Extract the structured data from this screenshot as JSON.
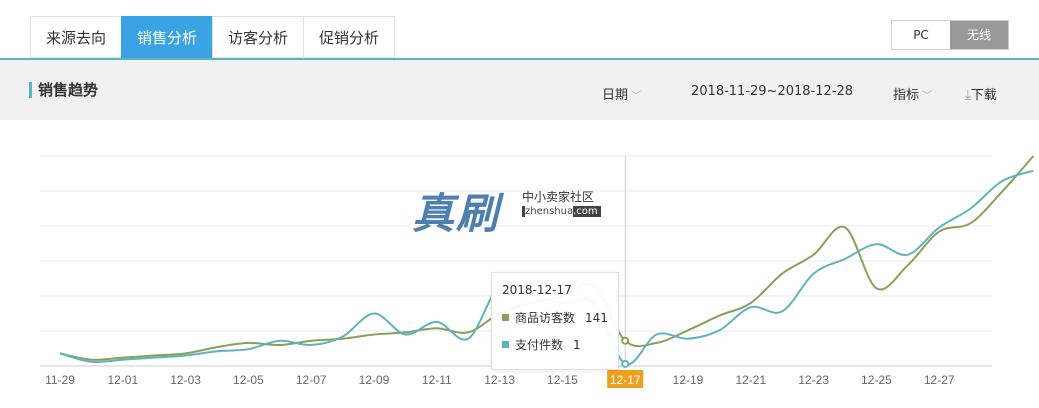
{
  "tabs": [
    {
      "label": "来源去向",
      "active": false
    },
    {
      "label": "销售分析",
      "active": true
    },
    {
      "label": "访客分析",
      "active": false
    },
    {
      "label": "促销分析",
      "active": false
    }
  ],
  "device_switch": {
    "pc": "PC",
    "wireless": "无线",
    "selected": "无线"
  },
  "header": {
    "title": "销售趋势",
    "date_label": "日期",
    "date_range": "2018-11-29~2018-12-28",
    "metric_label": "指标",
    "download_label": "下载",
    "accent_color": "#5ab6c0"
  },
  "watermark": {
    "big": "真刷",
    "small": "中小卖家社区",
    "domain_a": "zhenshua",
    "domain_b": ".com"
  },
  "tooltip": {
    "date": "2018-12-17",
    "rows": [
      {
        "label": "商品访客数",
        "value": "141",
        "color": "#8aa05a"
      },
      {
        "label": "支付件数",
        "value": "1",
        "color": "#5fb3bd"
      }
    ]
  },
  "chart_data": {
    "type": "line",
    "highlight_index": 18,
    "x_tick_labels": [
      "11-29",
      "12-01",
      "12-03",
      "12-05",
      "12-07",
      "12-09",
      "12-11",
      "12-13",
      "12-15",
      "12-17",
      "12-19",
      "12-21",
      "12-23",
      "12-25",
      "12-27"
    ],
    "series": [
      {
        "name": "商品访客数",
        "color": "#8aa05a",
        "values": [
          0.06,
          0.03,
          0.04,
          0.05,
          0.06,
          0.09,
          0.11,
          0.1,
          0.12,
          0.13,
          0.15,
          0.16,
          0.18,
          0.16,
          0.25,
          0.3,
          0.33,
          0.38,
          0.12,
          0.11,
          0.17,
          0.24,
          0.3,
          0.44,
          0.53,
          0.66,
          0.37,
          0.48,
          0.64,
          0.68,
          0.83,
          1.0
        ]
      },
      {
        "name": "支付件数",
        "color": "#5fb3bd",
        "values": [
          0.06,
          0.02,
          0.03,
          0.04,
          0.05,
          0.07,
          0.08,
          0.12,
          0.1,
          0.14,
          0.25,
          0.15,
          0.21,
          0.13,
          0.38,
          0.34,
          0.3,
          0.3,
          0.01,
          0.15,
          0.13,
          0.17,
          0.28,
          0.26,
          0.44,
          0.51,
          0.58,
          0.53,
          0.66,
          0.75,
          0.88,
          0.93
        ]
      }
    ],
    "grid": true
  }
}
